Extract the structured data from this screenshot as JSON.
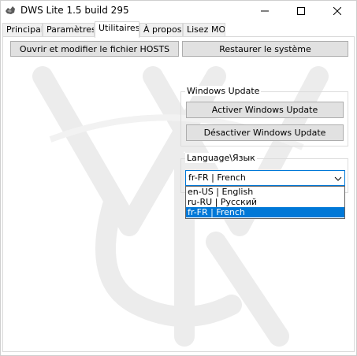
{
  "window": {
    "title": "DWS Lite 1.5 build 295"
  },
  "tabs": [
    {
      "label": "Principal",
      "active": false
    },
    {
      "label": "Paramètres",
      "active": false
    },
    {
      "label": "Utilitaires",
      "active": true
    },
    {
      "label": "À propos",
      "active": false
    },
    {
      "label": "Lisez MOI",
      "active": false
    }
  ],
  "utilities": {
    "hosts_button": "Ouvrir et modifier le fichier HOSTS",
    "restore_button": "Restaurer le système",
    "windows_update": {
      "group_title": "Windows Update",
      "enable_button": "Activer Windows Update",
      "disable_button": "Désactiver Windows Update"
    },
    "language": {
      "group_title": "Language\\Язык",
      "selected": "fr-FR | French",
      "options": [
        {
          "label": "en-US | English",
          "selected": false
        },
        {
          "label": "ru-RU | Русский",
          "selected": false
        },
        {
          "label": "fr-FR | French",
          "selected": true
        }
      ]
    }
  },
  "colors": {
    "accent": "#0078d7",
    "button_bg": "#e1e1e1",
    "button_border": "#adadad",
    "watermark": "#ececec"
  },
  "icons": {
    "app": "dws-app-icon",
    "minimize": "minimize-icon",
    "maximize": "maximize-icon",
    "close": "close-icon",
    "dropdown": "chevron-down-icon"
  }
}
